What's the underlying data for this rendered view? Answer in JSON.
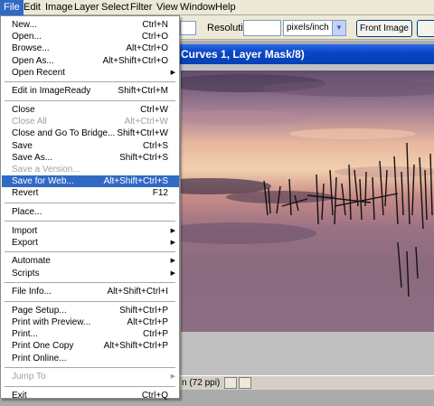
{
  "menubar": {
    "items": [
      "File",
      "Edit",
      "Image",
      "Layer",
      "Select",
      "Filter",
      "View",
      "Window",
      "Help"
    ],
    "active_index": 0
  },
  "options_bar": {
    "resolution_label": "Resolution:",
    "resolution_value": "",
    "units": "pixels/inch",
    "front_image_label": "Front Image"
  },
  "document": {
    "title": "Curves 1, Layer Mask/8)",
    "status_zoom": "n (72 ppi)"
  },
  "file_menu": {
    "items": [
      {
        "label": "New...",
        "shortcut": "Ctrl+N"
      },
      {
        "label": "Open...",
        "shortcut": "Ctrl+O"
      },
      {
        "label": "Browse...",
        "shortcut": "Alt+Ctrl+O"
      },
      {
        "label": "Open As...",
        "shortcut": "Alt+Shift+Ctrl+O"
      },
      {
        "label": "Open Recent",
        "submenu": true
      },
      {
        "separator": true
      },
      {
        "label": "Edit in ImageReady",
        "shortcut": "Shift+Ctrl+M"
      },
      {
        "separator": true
      },
      {
        "label": "Close",
        "shortcut": "Ctrl+W"
      },
      {
        "label": "Close All",
        "shortcut": "Alt+Ctrl+W",
        "disabled": true
      },
      {
        "label": "Close and Go To Bridge...",
        "shortcut": "Shift+Ctrl+W"
      },
      {
        "label": "Save",
        "shortcut": "Ctrl+S"
      },
      {
        "label": "Save As...",
        "shortcut": "Shift+Ctrl+S"
      },
      {
        "label": "Save a Version...",
        "disabled": true
      },
      {
        "label": "Save for Web...",
        "shortcut": "Alt+Shift+Ctrl+S",
        "highlighted": true
      },
      {
        "label": "Revert",
        "shortcut": "F12"
      },
      {
        "separator": true
      },
      {
        "label": "Place..."
      },
      {
        "separator": true
      },
      {
        "label": "Import",
        "submenu": true
      },
      {
        "label": "Export",
        "submenu": true
      },
      {
        "separator": true
      },
      {
        "label": "Automate",
        "submenu": true
      },
      {
        "label": "Scripts",
        "submenu": true
      },
      {
        "separator": true
      },
      {
        "label": "File Info...",
        "shortcut": "Alt+Shift+Ctrl+I"
      },
      {
        "separator": true
      },
      {
        "label": "Page Setup...",
        "shortcut": "Shift+Ctrl+P"
      },
      {
        "label": "Print with Preview...",
        "shortcut": "Alt+Ctrl+P"
      },
      {
        "label": "Print...",
        "shortcut": "Ctrl+P"
      },
      {
        "label": "Print One Copy",
        "shortcut": "Alt+Shift+Ctrl+P"
      },
      {
        "label": "Print Online..."
      },
      {
        "separator": true
      },
      {
        "label": "Jump To",
        "submenu": true,
        "disabled": true
      },
      {
        "separator": true
      },
      {
        "label": "Exit",
        "shortcut": "Ctrl+Q"
      }
    ]
  },
  "colors": {
    "highlight": "#316ac5",
    "title_bar": "#0a46c4",
    "disabled_text": "#a0a0a0"
  }
}
